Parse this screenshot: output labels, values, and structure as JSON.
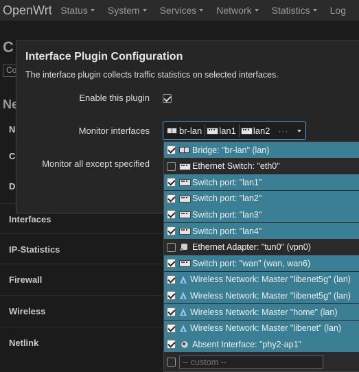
{
  "nav": {
    "brand": "OpenWrt",
    "items": [
      "Status",
      "System",
      "Services",
      "Network",
      "Statistics",
      "Log"
    ]
  },
  "background": {
    "page_title": "C",
    "subtab": "Co",
    "section": "Ne",
    "rows": [
      "N",
      "C",
      "D",
      "Interfaces",
      "IP-Statistics",
      "Firewall",
      "Wireless",
      "Netlink"
    ]
  },
  "modal": {
    "title": "Interface Plugin Configuration",
    "description": "The interface plugin collects traffic statistics on selected interfaces.",
    "enable_label": "Enable this plugin",
    "enable_checked": true,
    "monitor_label": "Monitor interfaces",
    "except_label": "Monitor all except specified",
    "selected_chips": [
      "br-lan",
      "lan1",
      "lan2"
    ],
    "more_indicator": "···"
  },
  "dropdown": {
    "options": [
      {
        "icon": "bridge-icon",
        "label": "Bridge: \"br-lan\" (lan)",
        "checked": true
      },
      {
        "icon": "switch-icon",
        "label": "Ethernet Switch: \"eth0\"",
        "checked": false
      },
      {
        "icon": "switch-icon",
        "label": "Switch port: \"lan1\"",
        "checked": true
      },
      {
        "icon": "switch-icon",
        "label": "Switch port: \"lan2\"",
        "checked": true
      },
      {
        "icon": "switch-icon",
        "label": "Switch port: \"lan3\"",
        "checked": true
      },
      {
        "icon": "switch-icon",
        "label": "Switch port: \"lan4\"",
        "checked": true
      },
      {
        "icon": "adapter-icon",
        "label": "Ethernet Adapter: \"tun0\" (vpn0)",
        "checked": false
      },
      {
        "icon": "switch-icon",
        "label": "Switch port: \"wan\" (wan, wan6)",
        "checked": true
      },
      {
        "icon": "wifi-icon",
        "label": "Wireless Network: Master \"libenet5g\" (lan)",
        "checked": true
      },
      {
        "icon": "wifi-icon",
        "label": "Wireless Network: Master \"libenet5g\" (lan)",
        "checked": true
      },
      {
        "icon": "wifi-icon",
        "label": "Wireless Network: Master \"home\" (lan)",
        "checked": true
      },
      {
        "icon": "wifi-icon",
        "label": "Wireless Network: Master \"libenet\" (lan)",
        "checked": true
      },
      {
        "icon": "absent-icon",
        "label": "Absent Interface: \"phy2-ap1\"",
        "checked": true
      }
    ],
    "custom_placeholder": "-- custom --"
  },
  "colors": {
    "selected_bg": "#3a7f93",
    "focus_border": "#5a9ed6"
  }
}
